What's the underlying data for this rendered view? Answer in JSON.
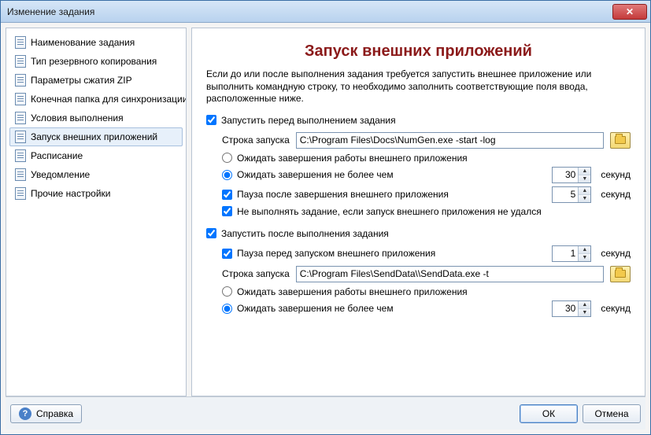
{
  "window": {
    "title": "Изменение задания"
  },
  "sidebar": {
    "items": [
      {
        "label": "Наименование задания"
      },
      {
        "label": "Тип резервного копирования"
      },
      {
        "label": "Параметры сжатия ZIP"
      },
      {
        "label": "Конечная папка для синхронизации"
      },
      {
        "label": "Условия выполнения"
      },
      {
        "label": "Запуск внешних приложений"
      },
      {
        "label": "Расписание"
      },
      {
        "label": "Уведомление"
      },
      {
        "label": "Прочие настройки"
      }
    ],
    "selected_index": 5
  },
  "page": {
    "title": "Запуск внешних приложений",
    "description": "Если до или после выполнения задания требуется запустить внешнее приложение или выполнить командную строку, то необходимо заполнить соответствующие поля ввода, расположенные ниже."
  },
  "before": {
    "enable_label": "Запустить перед выполнением задания",
    "enable_checked": true,
    "cmd_label": "Строка запуска",
    "cmd_value": "C:\\Program Files\\Docs\\NumGen.exe -start -log",
    "wait_radio_label": "Ожидать завершения работы внешнего приложения",
    "wait_timeout_label": "Ожидать завершения не более чем",
    "wait_timeout_value": "30",
    "wait_mode": "timeout",
    "unit_seconds": "секунд",
    "pause_after_label": "Пауза после завершения внешнего приложения",
    "pause_after_checked": true,
    "pause_after_value": "5",
    "fail_if_label": "Не выполнять задание, если запуск внешнего приложения не удался",
    "fail_if_checked": true
  },
  "after": {
    "enable_label": "Запустить после выполнения задания",
    "enable_checked": true,
    "pause_before_label": "Пауза перед запуском внешнего приложения",
    "pause_before_checked": true,
    "pause_before_value": "1",
    "cmd_label": "Строка запуска",
    "cmd_value": "C:\\Program Files\\SendData\\\\SendData.exe -t",
    "wait_radio_label": "Ожидать завершения работы внешнего приложения",
    "wait_timeout_label": "Ожидать завершения не более чем",
    "wait_timeout_value": "30",
    "wait_mode": "timeout",
    "unit_seconds": "секунд"
  },
  "buttons": {
    "help": "Справка",
    "ok": "ОК",
    "cancel": "Отмена"
  }
}
